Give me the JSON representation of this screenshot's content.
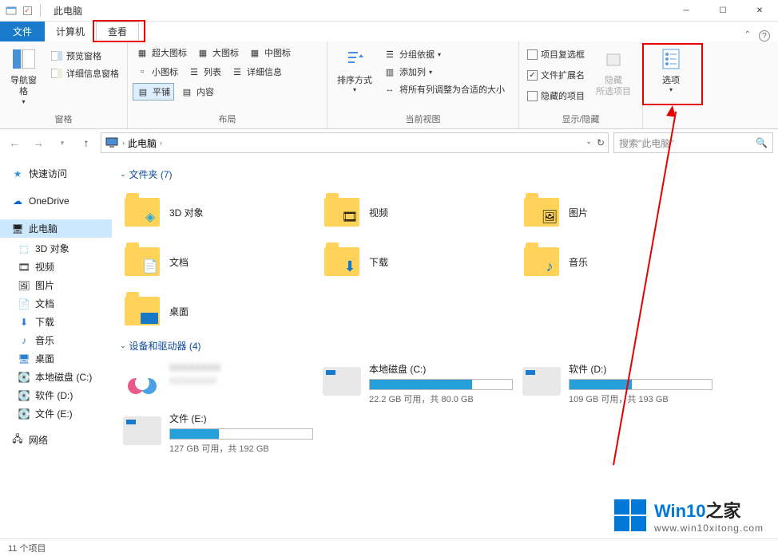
{
  "window": {
    "title": "此电脑"
  },
  "tabs": {
    "file": "文件",
    "computer": "计算机",
    "view": "查看"
  },
  "ribbon": {
    "panes": {
      "nav_pane": "导航窗格",
      "preview": "预览窗格",
      "details": "详细信息窗格",
      "label": "窗格"
    },
    "layout": {
      "extra_large": "超大图标",
      "large": "大图标",
      "medium": "中图标",
      "small": "小图标",
      "list": "列表",
      "details": "详细信息",
      "tiles": "平铺",
      "content": "内容",
      "label": "布局"
    },
    "view": {
      "sort": "排序方式",
      "group": "分组依据",
      "add_col": "添加列",
      "fit_cols": "将所有列调整为合适的大小",
      "label": "当前视图"
    },
    "show_hide": {
      "checkboxes": "项目复选框",
      "extensions": "文件扩展名",
      "hidden": "隐藏的项目",
      "hide_selected": "隐藏\n所选项目",
      "label": "显示/隐藏"
    },
    "options": "选项"
  },
  "address": {
    "location": "此电脑",
    "search_placeholder": "搜索\"此电脑\""
  },
  "sidebar": {
    "quick": "快速访问",
    "onedrive": "OneDrive",
    "pc": "此电脑",
    "pc_children": [
      "3D 对象",
      "视频",
      "图片",
      "文档",
      "下载",
      "音乐",
      "桌面",
      "本地磁盘 (C:)",
      "软件 (D:)",
      "文件 (E:)"
    ],
    "network": "网络"
  },
  "content": {
    "folders_hdr": "文件夹 (7)",
    "folders": [
      "3D 对象",
      "视频",
      "图片",
      "文档",
      "下载",
      "音乐",
      "桌面"
    ],
    "drives_hdr": "设备和驱动器 (4)",
    "drives": [
      {
        "name": "",
        "stat": "",
        "pct": 0
      },
      {
        "name": "本地磁盘 (C:)",
        "stat": "22.2 GB 可用，共 80.0 GB",
        "pct": 72
      },
      {
        "name": "软件 (D:)",
        "stat": "109 GB 可用，共 193 GB",
        "pct": 44
      },
      {
        "name": "文件 (E:)",
        "stat": "127 GB 可用，共 192 GB",
        "pct": 34
      }
    ]
  },
  "status": {
    "count": "11 个项目"
  },
  "watermark": {
    "brand_a": "Win10",
    "brand_b": "之家",
    "url": "www.win10xitong.com"
  }
}
